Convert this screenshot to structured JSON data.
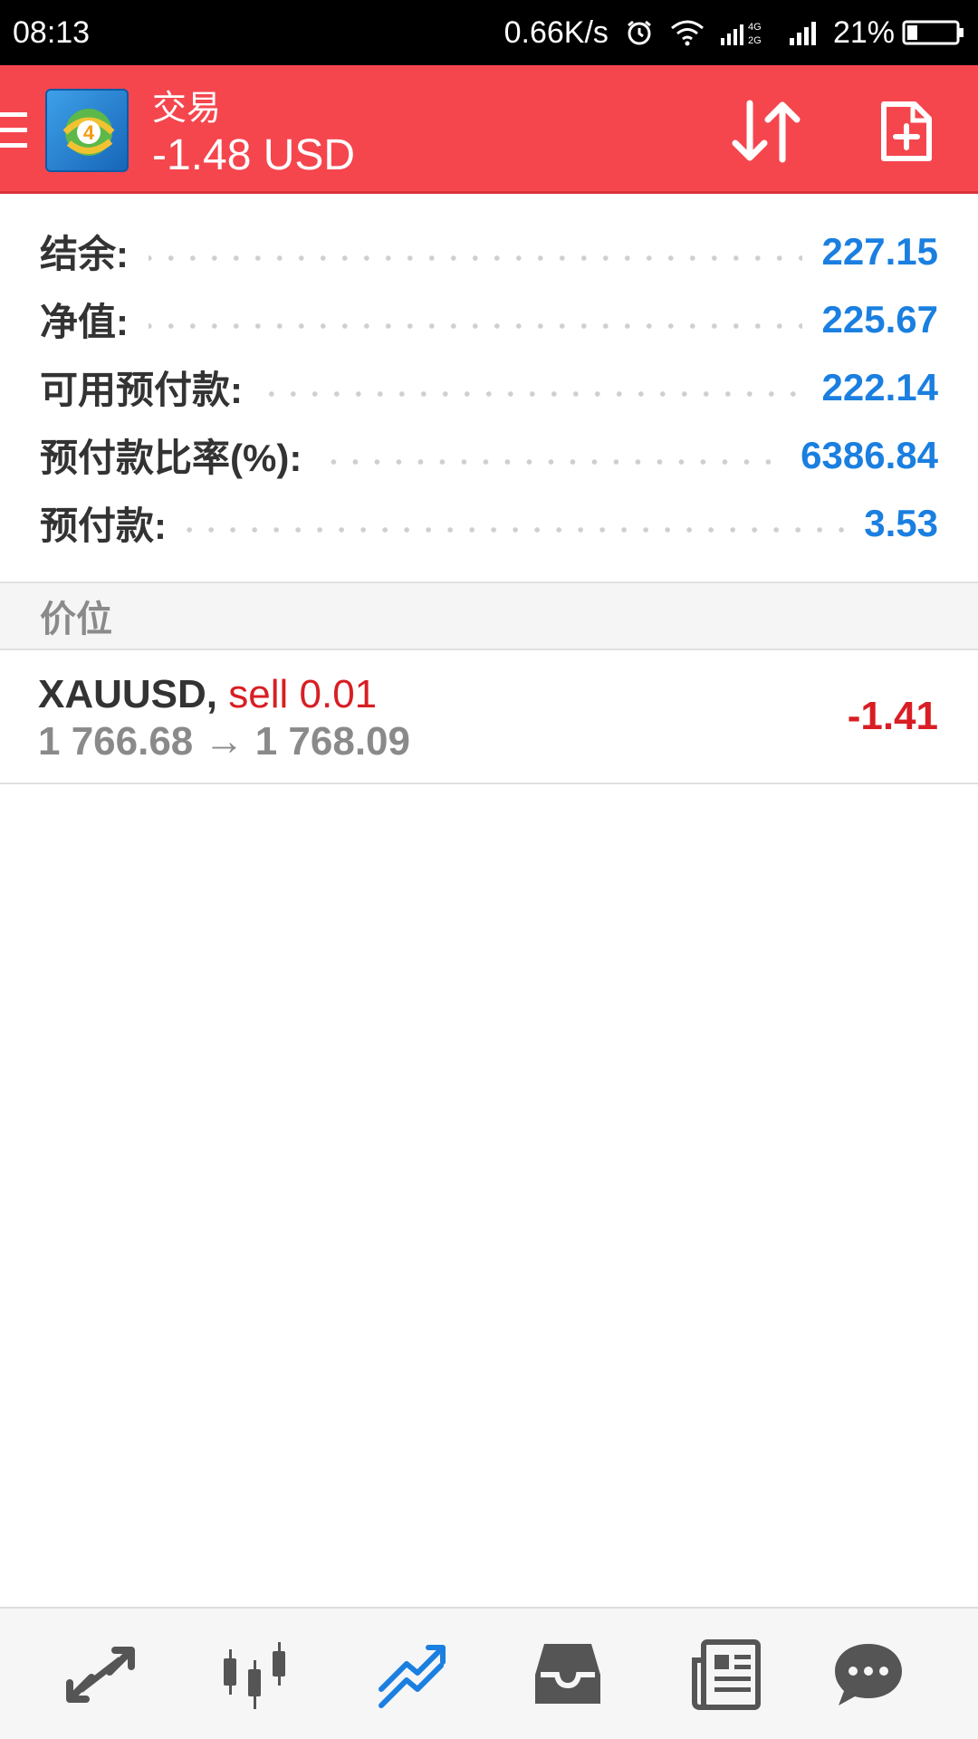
{
  "status_bar": {
    "time": "08:13",
    "network_speed": "0.66K/s",
    "battery": "21%",
    "icons": [
      "alarm-icon",
      "wifi-icon",
      "signal-4g-2g-icon",
      "signal-icon",
      "battery-icon"
    ],
    "battery_level": 0.21
  },
  "header": {
    "title": "交易",
    "subtitle": "-1.48 USD",
    "icons": [
      "menu-icon",
      "app-logo",
      "sort-icon",
      "new-order-icon"
    ],
    "background": "#f5464e"
  },
  "summary": [
    {
      "label": "结余:",
      "value": "227.15"
    },
    {
      "label": "净值:",
      "value": "225.67"
    },
    {
      "label": "可用预付款:",
      "value": "222.14"
    },
    {
      "label": "预付款比率(%):",
      "value": "6386.84"
    },
    {
      "label": "预付款:",
      "value": "3.53"
    }
  ],
  "section": {
    "title": "价位"
  },
  "positions": [
    {
      "symbol": "XAUUSD,",
      "trade": "sell 0.01",
      "prices": "1 766.68 → 1 768.09",
      "profit": "-1.41"
    }
  ],
  "bottom_nav": {
    "items": [
      "quotes-icon",
      "chart-icon",
      "trade-icon",
      "history-icon",
      "news-icon",
      "chat-icon"
    ],
    "active": "trade-icon",
    "active_color": "#1a7fe0",
    "inactive_color": "#555555"
  },
  "colors": {
    "value_blue": "#1a7fe0",
    "loss_red": "#d81e24"
  }
}
